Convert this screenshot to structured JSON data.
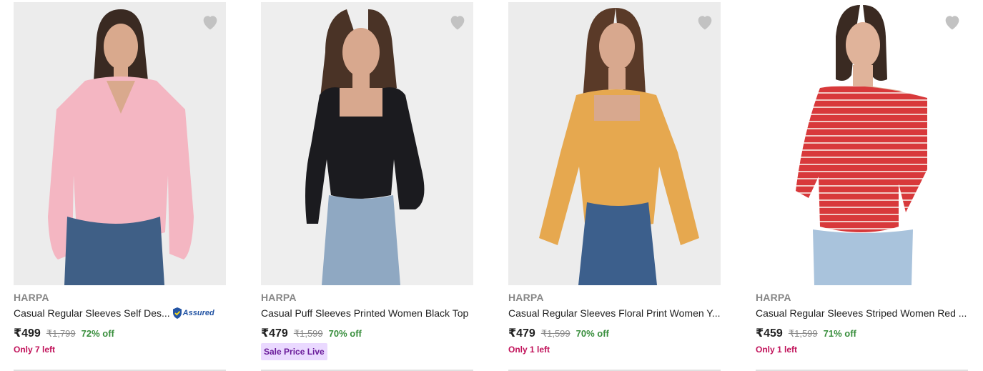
{
  "products": [
    {
      "brand": "HARPA",
      "title": "Casual Regular Sleeves Self Des...",
      "assured_label": "Assured",
      "price": "₹499",
      "mrp": "₹1,799",
      "discount": "72% off",
      "stock_note": "Only 7 left",
      "colors": {
        "top": "#f4b6c2",
        "bottom": "#3f5f86",
        "bg": "#ececec",
        "skin": "#d9a98d",
        "hair": "#3a2a22"
      }
    },
    {
      "brand": "HARPA",
      "title": "Casual Puff Sleeves Printed Women Black Top",
      "price": "₹479",
      "mrp": "₹1,599",
      "discount": "70% off",
      "sale_tag": "Sale Price Live",
      "colors": {
        "top": "#1b1b1f",
        "bottom": "#8fa8c2",
        "bg": "#eeeeee",
        "skin": "#d8a88e",
        "hair": "#4a3326"
      }
    },
    {
      "brand": "HARPA",
      "title": "Casual Regular Sleeves Floral Print Women Y...",
      "price": "₹479",
      "mrp": "₹1,599",
      "discount": "70% off",
      "stock_note": "Only 1 left",
      "colors": {
        "top": "#e6a84f",
        "bottom": "#3c5f8c",
        "bg": "#ececec",
        "skin": "#d8a88e",
        "hair": "#5a3a28"
      }
    },
    {
      "brand": "HARPA",
      "title": "Casual Regular Sleeves Striped Women Red ...",
      "price": "₹459",
      "mrp": "₹1,599",
      "discount": "71% off",
      "stock_note": "Only 1 left",
      "colors": {
        "top": "#d8393b",
        "bottom": "#a9c3dc",
        "bg": "#ffffff",
        "skin": "#e0b39a",
        "hair": "#3a2a22"
      }
    }
  ],
  "icons": {
    "wishlist": "heart-icon",
    "assured": "assured-badge-icon"
  }
}
